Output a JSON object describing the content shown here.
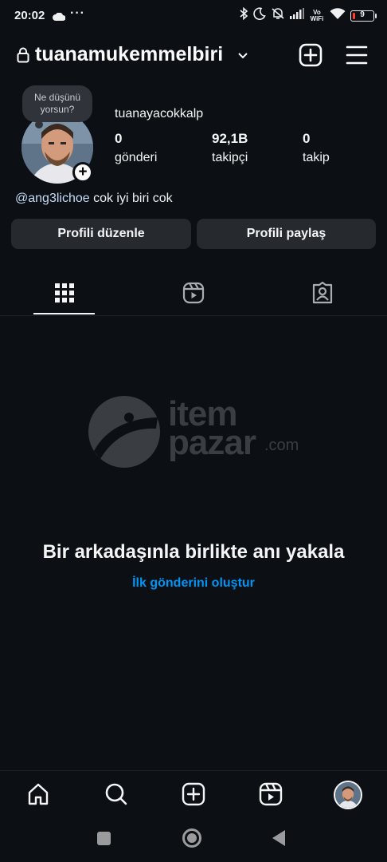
{
  "status_bar": {
    "time": "20:02",
    "dots": "···",
    "vowifi": "Vo WiFi",
    "battery": "9",
    "icons": [
      "cloud-icon",
      "bluetooth-icon",
      "moon-icon",
      "muted-bell-icon",
      "signal-icon",
      "wifi-icon",
      "battery-icon"
    ]
  },
  "header": {
    "username": "tuanamukemmelbiri",
    "icons": [
      "lock-icon",
      "chevron-down-icon",
      "plus-square-icon",
      "hamburger-menu-icon"
    ]
  },
  "profile": {
    "note": "Ne düşünü yorsun?",
    "display_name": "tuanayacokkalp",
    "stats": [
      {
        "value": "0",
        "label": "gönderi"
      },
      {
        "value": "92,1B",
        "label": "takipçi"
      },
      {
        "value": "0",
        "label": "takip"
      }
    ],
    "bio_mention": "@ang3lichoe",
    "bio_text": " cok iyi biri cok",
    "edit_button": "Profili düzenle",
    "share_button": "Profili paylaş"
  },
  "tabs": [
    {
      "icon": "grid-icon",
      "active": true
    },
    {
      "icon": "reels-icon",
      "active": false
    },
    {
      "icon": "tagged-icon",
      "active": false
    }
  ],
  "watermark": {
    "line1": "item",
    "line2": "pazar",
    "suffix": ".com"
  },
  "empty_state": {
    "title": "Bir arkadaşınla birlikte anı yakala",
    "link": "İlk gönderini oluştur"
  },
  "bottom_nav": [
    "home-icon",
    "search-icon",
    "create-icon",
    "reels-icon",
    "profile-avatar"
  ],
  "colors": {
    "background": "#0c1014",
    "button": "#262a2f",
    "link": "#0095f6",
    "mention": "#c6dbf7"
  }
}
